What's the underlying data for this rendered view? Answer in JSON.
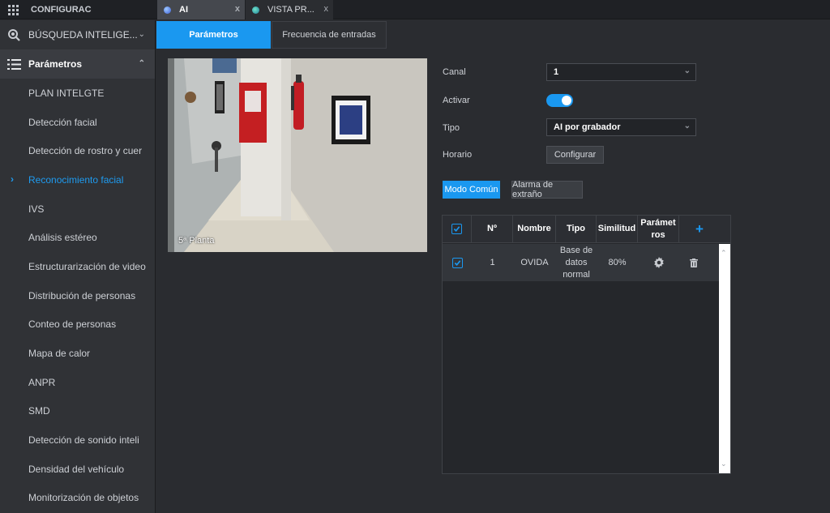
{
  "app": {
    "title": "CONFIGURAC"
  },
  "tabs": [
    {
      "label": "AI",
      "close": "x"
    },
    {
      "label": "VISTA PR...",
      "close": "x"
    }
  ],
  "sidebar": {
    "section1": "BÚSQUEDA INTELIGE...",
    "section2": "Parámetros",
    "items": [
      "PLAN INTELGTE",
      "Detección facial",
      "Detección de rostro y cuer",
      "Reconocimiento facial",
      "IVS",
      "Análisis estéreo",
      "Estructurarización de video",
      "Distribución de personas",
      "Conteo de personas",
      "Mapa de calor",
      "ANPR",
      "SMD",
      "Detección de sonido inteli",
      "Densidad del vehículo",
      "Monitorización de objetos"
    ],
    "active_index": 3
  },
  "subtabs": {
    "params": "Parámetros",
    "freq": "Frecuencia de entradas"
  },
  "camera": {
    "label": "5ª Planta"
  },
  "form": {
    "canal_label": "Canal",
    "canal_value": "1",
    "activar_label": "Activar",
    "activar_on": true,
    "tipo_label": "Tipo",
    "tipo_value": "AI por grabador",
    "horario_label": "Horario",
    "configurar": "Configurar"
  },
  "buttons": {
    "modo": "Modo Común",
    "alarma": "Alarma de extraño"
  },
  "table": {
    "headers": [
      "Nº",
      "Nombre",
      "Tipo",
      "Similitud",
      "Parámetros",
      "+"
    ],
    "rows": [
      {
        "no": "1",
        "nombre": "OVIDA",
        "tipo": "Base de datos normal",
        "similitud": "80%"
      }
    ]
  },
  "colors": {
    "accent": "#1a98f0",
    "background": "#2a2c30",
    "sidebar": "#303236"
  }
}
